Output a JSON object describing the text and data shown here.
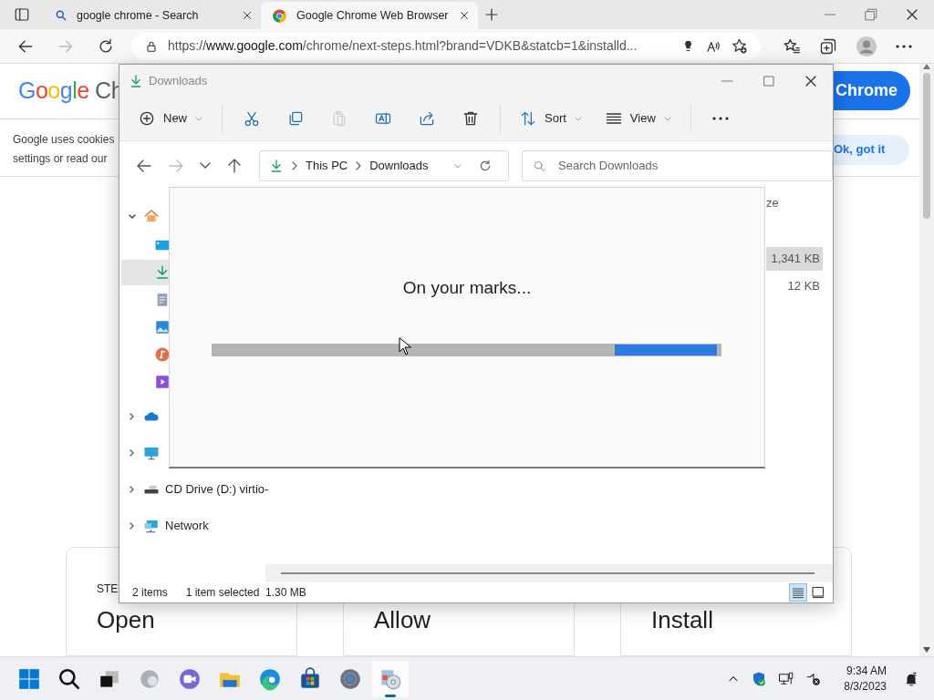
{
  "browser": {
    "tabs": [
      {
        "kind": "search",
        "title": "google chrome - Search",
        "selected": false
      },
      {
        "kind": "chrome",
        "title": "Google Chrome Web Browser",
        "selected": true
      }
    ],
    "url": "https://www.google.com/chrome/next-steps.html?brand=VDKB&statcb=1&installd...",
    "page": {
      "logo": "Google",
      "logo_suffix": "Ch",
      "download_button": "Chrome",
      "cookie_notice": {
        "line1": "Google uses cookies",
        "link1": "settings",
        "text": "or",
        "link2": "read our"
      },
      "ok_button": "Ok, got it",
      "steps": [
        {
          "label": "STE",
          "title": "Open"
        },
        {
          "title": "Allow"
        },
        {
          "title": "Install"
        }
      ]
    }
  },
  "explorer": {
    "title": "Downloads",
    "toolbar": [
      {
        "kind": "new",
        "label": "New",
        "disabled": false
      },
      {
        "kind": "cut",
        "disabled": false
      },
      {
        "kind": "copy",
        "disabled": false
      },
      {
        "kind": "paste",
        "disabled": true
      },
      {
        "kind": "rename",
        "disabled": false
      },
      {
        "kind": "share",
        "disabled": false
      },
      {
        "kind": "delete",
        "disabled": false
      },
      {
        "kind": "sort",
        "label": "Sort",
        "disabled": false
      },
      {
        "kind": "view",
        "label": "View",
        "disabled": false
      },
      {
        "kind": "more",
        "disabled": false
      }
    ],
    "nav_buttons": [
      {
        "kind": "back",
        "disabled": false
      },
      {
        "kind": "forward",
        "disabled": true
      },
      {
        "kind": "recent",
        "disabled": false
      },
      {
        "kind": "up",
        "disabled": false
      }
    ],
    "breadcrumb": [
      "This PC",
      "Downloads"
    ],
    "search": {
      "placeholder": "Search Downloads"
    },
    "sidebar": [
      {
        "kind": "home",
        "expanded": true,
        "selected": false,
        "children": [
          {
            "kind": "desktop",
            "selected": false
          },
          {
            "kind": "downloads",
            "selected": true
          },
          {
            "kind": "documents",
            "selected": false
          },
          {
            "kind": "pictures",
            "selected": false
          },
          {
            "kind": "music",
            "selected": false
          },
          {
            "kind": "videos",
            "selected": false
          }
        ]
      },
      {
        "kind": "onedrive",
        "expanded": false,
        "selected": false
      },
      {
        "kind": "thispc",
        "expanded": false,
        "selected": false
      },
      {
        "kind": "cddrive",
        "label": "CD Drive (D:) virtio-",
        "expanded": false,
        "selected": false
      },
      {
        "kind": "network",
        "label": "Network",
        "expanded": false,
        "selected": false
      }
    ],
    "column_header": "ze",
    "rows": [
      {
        "size": "1,341 KB",
        "selected": true
      },
      {
        "size": "12 KB",
        "selected": false
      }
    ],
    "status": {
      "count": "2 items",
      "selection": "1 item selected",
      "size": "1.30 MB"
    },
    "view_buttons": [
      {
        "kind": "details",
        "selected": true
      },
      {
        "kind": "tiles",
        "selected": false
      }
    ]
  },
  "installer": {
    "message": "On your marks...",
    "progress": {
      "level": 0.2
    }
  },
  "taskbar": {
    "apps": [
      {
        "kind": "start",
        "active": false
      },
      {
        "kind": "search",
        "active": false
      },
      {
        "kind": "taskview",
        "active": false
      },
      {
        "kind": "widgets",
        "active": false
      },
      {
        "kind": "chat",
        "active": false
      },
      {
        "kind": "explorer",
        "active": false
      },
      {
        "kind": "edge",
        "active": false
      },
      {
        "kind": "store",
        "active": false
      },
      {
        "kind": "settings",
        "active": false
      },
      {
        "kind": "installer",
        "active": true
      }
    ],
    "time": "9:34 AM",
    "date": "8/3/2023"
  }
}
